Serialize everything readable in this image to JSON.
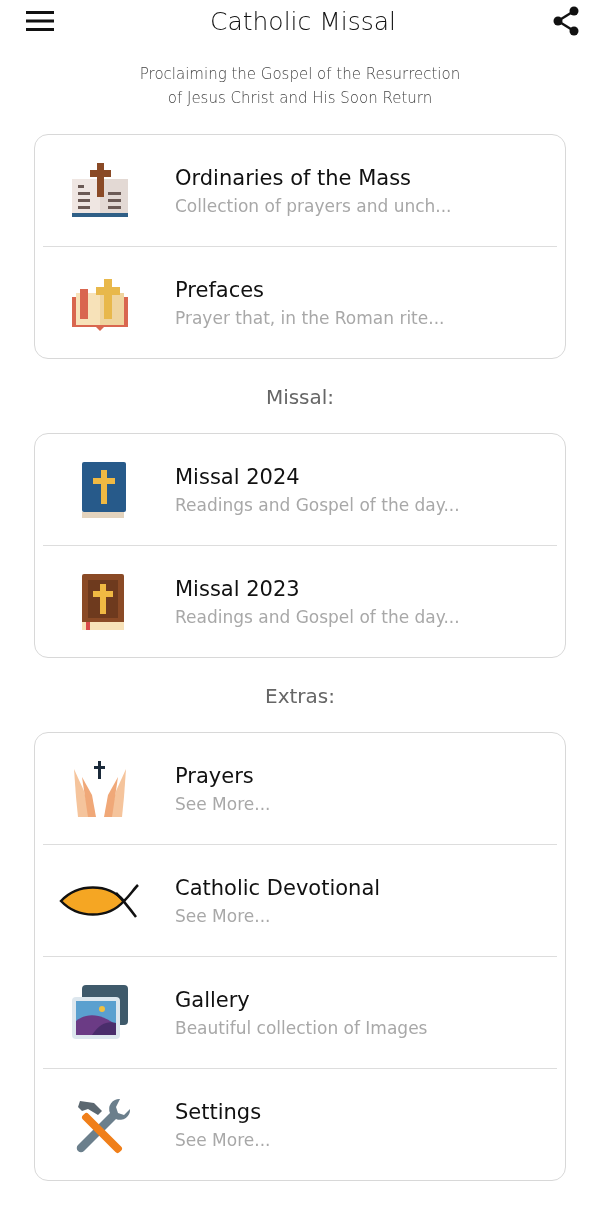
{
  "app_bar": {
    "title": "Catholic Missal"
  },
  "tagline": "Proclaiming the Gospel of the Resurrection\nof Jesus Christ and His Soon Return",
  "sections": [
    {
      "items": [
        {
          "title": "Ordinaries of the Mass",
          "subtitle": "Collection of prayers and unch..."
        },
        {
          "title": "Prefaces",
          "subtitle": "Prayer that, in the Roman rite..."
        }
      ]
    },
    {
      "heading": "Missal:",
      "items": [
        {
          "title": "Missal 2024",
          "subtitle": "Readings and Gospel of the day..."
        },
        {
          "title": "Missal 2023",
          "subtitle": "Readings and Gospel of the day..."
        }
      ]
    },
    {
      "heading": "Extras:",
      "items": [
        {
          "title": "Prayers",
          "subtitle": "See More..."
        },
        {
          "title": "Catholic Devotional",
          "subtitle": "See More..."
        },
        {
          "title": "Gallery",
          "subtitle": "Beautiful collection of Images"
        },
        {
          "title": "Settings",
          "subtitle": "See More..."
        }
      ]
    }
  ]
}
